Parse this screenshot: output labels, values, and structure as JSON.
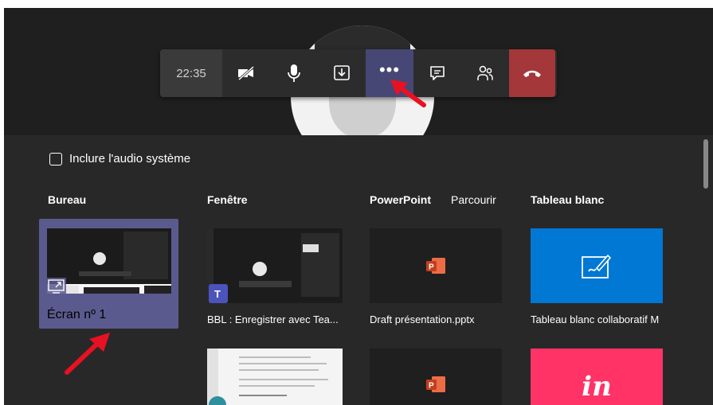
{
  "toolbar": {
    "time": "22:35",
    "buttons": [
      {
        "name": "camera-off-icon"
      },
      {
        "name": "microphone-icon"
      },
      {
        "name": "share-tray-icon"
      },
      {
        "name": "more-actions-icon"
      },
      {
        "name": "chat-icon"
      },
      {
        "name": "participants-icon"
      },
      {
        "name": "hang-up-icon"
      }
    ],
    "more_label": "•••",
    "hangup_color": "#a4373a",
    "active_color": "#464775"
  },
  "share_panel": {
    "include_audio_label": "Inclure l'audio système",
    "columns": {
      "desktop": "Bureau",
      "window": "Fenêtre",
      "powerpoint": "PowerPoint",
      "browse": "Parcourir",
      "whiteboard": "Tableau blanc"
    },
    "tiles": {
      "desktop_screen": "Écran nº 1",
      "window_item": "BBL : Enregistrer avec Tea...",
      "ppt_file": "Draft présentation.pptx",
      "whiteboard_app": "Tableau blanc collaboratif M",
      "invision_logo": "in"
    },
    "selected_color": "#5b5a8f",
    "whiteboard_color": "#0078d4",
    "invision_color": "#ff3366"
  }
}
